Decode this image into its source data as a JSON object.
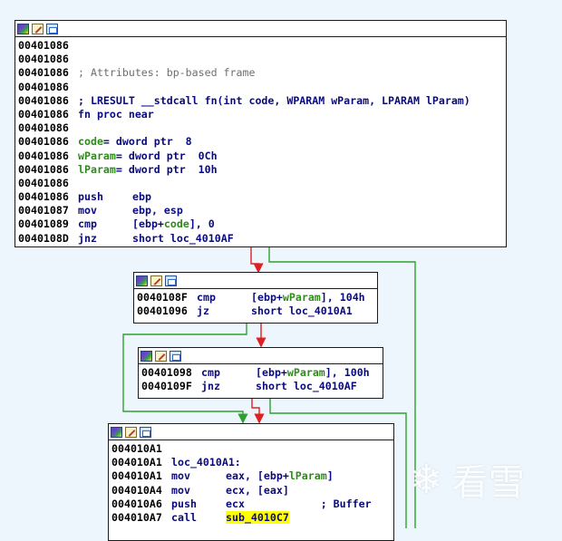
{
  "nodes": {
    "n1": [
      {
        "addr": "00401086"
      },
      {
        "addr": "00401086"
      },
      {
        "addr": "00401086",
        "parts": [
          [
            "c-comment",
            "; Attributes: bp-based frame"
          ]
        ]
      },
      {
        "addr": "00401086"
      },
      {
        "addr": "00401086",
        "parts": [
          [
            "c-blue",
            "; LRESULT __stdcall fn(int code, WPARAM wParam, LPARAM lParam)"
          ]
        ]
      },
      {
        "addr": "00401086",
        "parts": [
          [
            "c-blue",
            "fn proc near"
          ]
        ]
      },
      {
        "addr": "00401086"
      },
      {
        "addr": "00401086",
        "parts": [
          [
            "c-green",
            "code"
          ],
          [
            "c-blue",
            "= dword ptr  8"
          ]
        ]
      },
      {
        "addr": "00401086",
        "parts": [
          [
            "c-green",
            "wParam"
          ],
          [
            "c-blue",
            "= dword ptr  0Ch"
          ]
        ]
      },
      {
        "addr": "00401086",
        "parts": [
          [
            "c-green",
            "lParam"
          ],
          [
            "c-blue",
            "= dword ptr  10h"
          ]
        ]
      },
      {
        "addr": "00401086"
      },
      {
        "addr": "00401086",
        "mnem": "push",
        "parts": [
          [
            "c-blue",
            "ebp"
          ]
        ]
      },
      {
        "addr": "00401087",
        "mnem": "mov",
        "parts": [
          [
            "c-blue",
            "ebp, esp"
          ]
        ]
      },
      {
        "addr": "00401089",
        "mnem": "cmp",
        "parts": [
          [
            "c-blue",
            "[ebp+"
          ],
          [
            "c-green",
            "code"
          ],
          [
            "c-blue",
            "], 0"
          ]
        ]
      },
      {
        "addr": "0040108D",
        "mnem": "jnz",
        "parts": [
          [
            "c-blue",
            "short loc_4010AF"
          ]
        ]
      }
    ],
    "n2": [
      {
        "addr": "0040108F",
        "mnem": "cmp",
        "parts": [
          [
            "c-blue",
            "[ebp+"
          ],
          [
            "c-green",
            "wParam"
          ],
          [
            "c-blue",
            "], 104h"
          ]
        ]
      },
      {
        "addr": "00401096",
        "mnem": "jz",
        "parts": [
          [
            "c-blue",
            "short loc_4010A1"
          ]
        ]
      }
    ],
    "n3": [
      {
        "addr": "00401098",
        "mnem": "cmp",
        "parts": [
          [
            "c-blue",
            "[ebp+"
          ],
          [
            "c-green",
            "wParam"
          ],
          [
            "c-blue",
            "], 100h"
          ]
        ]
      },
      {
        "addr": "0040109F",
        "mnem": "jnz",
        "parts": [
          [
            "c-blue",
            "short loc_4010AF"
          ]
        ]
      }
    ],
    "n4": [
      {
        "addr": "004010A1"
      },
      {
        "addr": "004010A1",
        "parts": [
          [
            "c-blue",
            "loc_4010A1:"
          ]
        ]
      },
      {
        "addr": "004010A1",
        "mnem": "mov",
        "parts": [
          [
            "c-blue",
            "eax, [ebp+"
          ],
          [
            "c-green",
            "lParam"
          ],
          [
            "c-blue",
            "]"
          ]
        ]
      },
      {
        "addr": "004010A4",
        "mnem": "mov",
        "parts": [
          [
            "c-blue",
            "ecx, [eax]"
          ]
        ]
      },
      {
        "addr": "004010A6",
        "mnem": "push",
        "parts": [
          [
            "c-blue",
            "ecx            "
          ],
          [
            "c-blue",
            "; Buffer"
          ]
        ]
      },
      {
        "addr": "004010A7",
        "mnem": "call",
        "parts": [
          [
            "c-hl",
            "sub_4010C7"
          ]
        ]
      }
    ]
  },
  "header_icons": [
    "graph-view-icon",
    "edit-icon",
    "image-icon"
  ],
  "watermark": {
    "symbol": "❄",
    "text": "看雪"
  },
  "colors": {
    "edge_true": "#2fa02f",
    "edge_false": "#e02020",
    "edge_uncond": "#2f6ad0"
  }
}
